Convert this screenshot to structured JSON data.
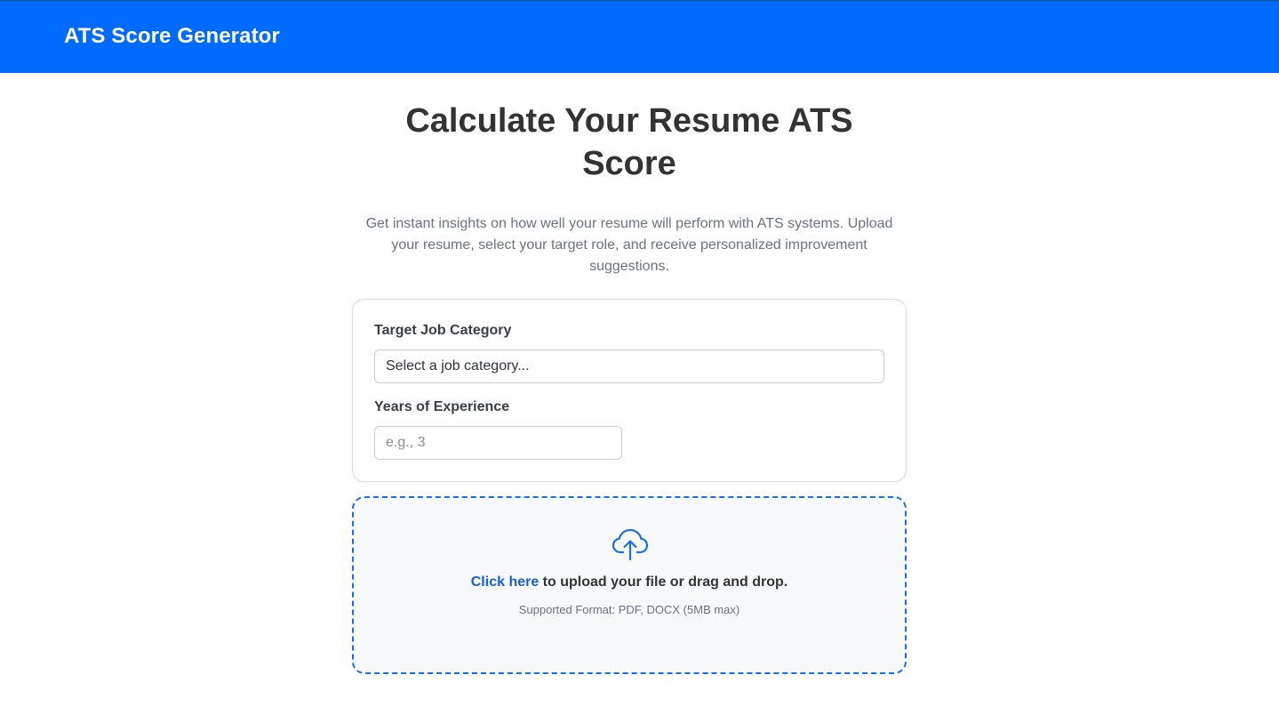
{
  "header": {
    "title": "ATS Score Generator",
    "background_color": "#006bff"
  },
  "hero": {
    "title": "Calculate Your Resume ATS Score",
    "subtitle": "Get instant insights on how well your resume will perform with ATS systems. Upload your resume, select your target role, and receive personalized improvement suggestions."
  },
  "form": {
    "job_category": {
      "label": "Target Job Category",
      "selected_value": "Select a job category..."
    },
    "experience": {
      "label": "Years of Experience",
      "placeholder": "e.g., 3",
      "value": ""
    }
  },
  "upload": {
    "icon": "cloud-upload-icon",
    "link_text": "Click here",
    "prompt_text": " to upload your file or drag and drop.",
    "supported_formats": "Supported Format: PDF, DOCX (5MB max)",
    "accent_color": "#1a6fe8"
  }
}
